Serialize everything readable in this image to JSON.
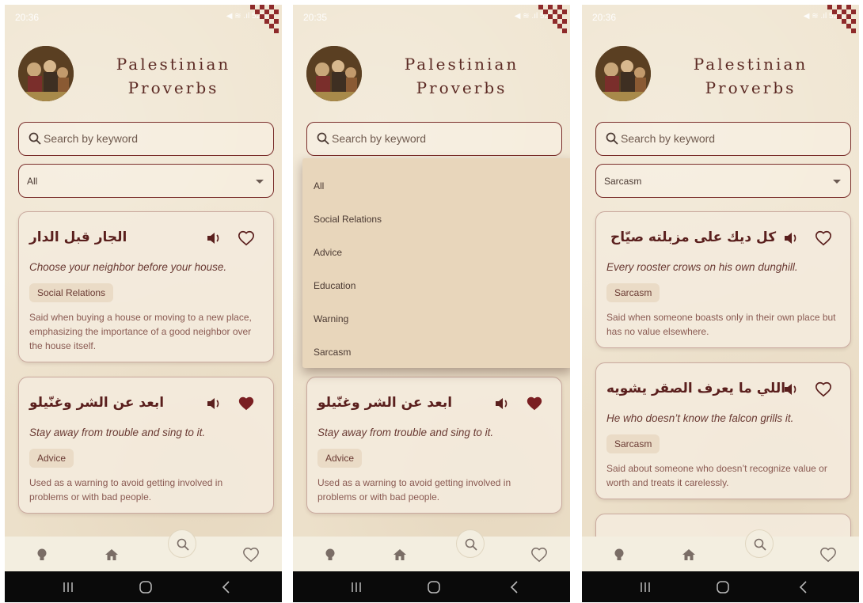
{
  "screens": [
    {
      "status": {
        "time": "20:36",
        "icons": "◀ ≋ .ıl 52%"
      },
      "app": {
        "title_line1": "Palestinian",
        "title_line2": "Proverbs"
      },
      "search": {
        "placeholder": "Search by keyword"
      },
      "filter": {
        "selected": "All"
      },
      "cards": [
        {
          "arabic": "الجار قبل الدار",
          "english": "Choose your neighbor before your house.",
          "category": "Social Relations",
          "description": "Said when buying a house or moving to a new place, emphasizing the importance of a good neighbor over the house itself.",
          "favorite": false
        },
        {
          "arabic": "ابعد عن الشر وغنّيلو",
          "english": "Stay away from trouble and sing to it.",
          "category": "Advice",
          "description": "Used as a warning to avoid getting involved in problems or with bad people.",
          "favorite": true
        }
      ]
    },
    {
      "status": {
        "time": "20:35",
        "icons": "◀ ≋ .ıl 52%"
      },
      "app": {
        "title_line1": "Palestinian",
        "title_line2": "Proverbs"
      },
      "search": {
        "placeholder": "Search by keyword"
      },
      "dropdown_options": [
        "All",
        "Social Relations",
        "Advice",
        "Education",
        "Warning",
        "Sarcasm"
      ],
      "cards": [
        {
          "arabic": "ابعد عن الشر وغنّيلو",
          "english": "Stay away from trouble and sing to it.",
          "category": "Advice",
          "description": "Used as a warning to avoid getting involved in problems or with bad people.",
          "favorite": true
        }
      ]
    },
    {
      "status": {
        "time": "20:36",
        "icons": "◀ ≋ .ıl 52%"
      },
      "app": {
        "title_line1": "Palestinian",
        "title_line2": "Proverbs"
      },
      "search": {
        "placeholder": "Search by keyword"
      },
      "filter": {
        "selected": "Sarcasm"
      },
      "cards": [
        {
          "arabic": "كل ديك على مزبلته صيّاح",
          "english": "Every rooster crows on his own dunghill.",
          "category": "Sarcasm",
          "description": "Said when someone boasts only in their own place but has no value elsewhere.",
          "favorite": false
        },
        {
          "arabic": "اللي ما يعرف الصقر يشويه",
          "english": "He who doesn’t know the falcon grills it.",
          "category": "Sarcasm",
          "description": "Said about someone who doesn’t recognize value or worth and treats it carelessly.",
          "favorite": false
        }
      ]
    }
  ],
  "nav": {
    "items": [
      "tips-icon",
      "home-icon",
      "search-icon",
      "favorites-icon"
    ]
  },
  "colors": {
    "accent": "#7a2e2b",
    "background": "#efe4cf",
    "card": "#f3eadc",
    "tag": "#eadbc6"
  }
}
